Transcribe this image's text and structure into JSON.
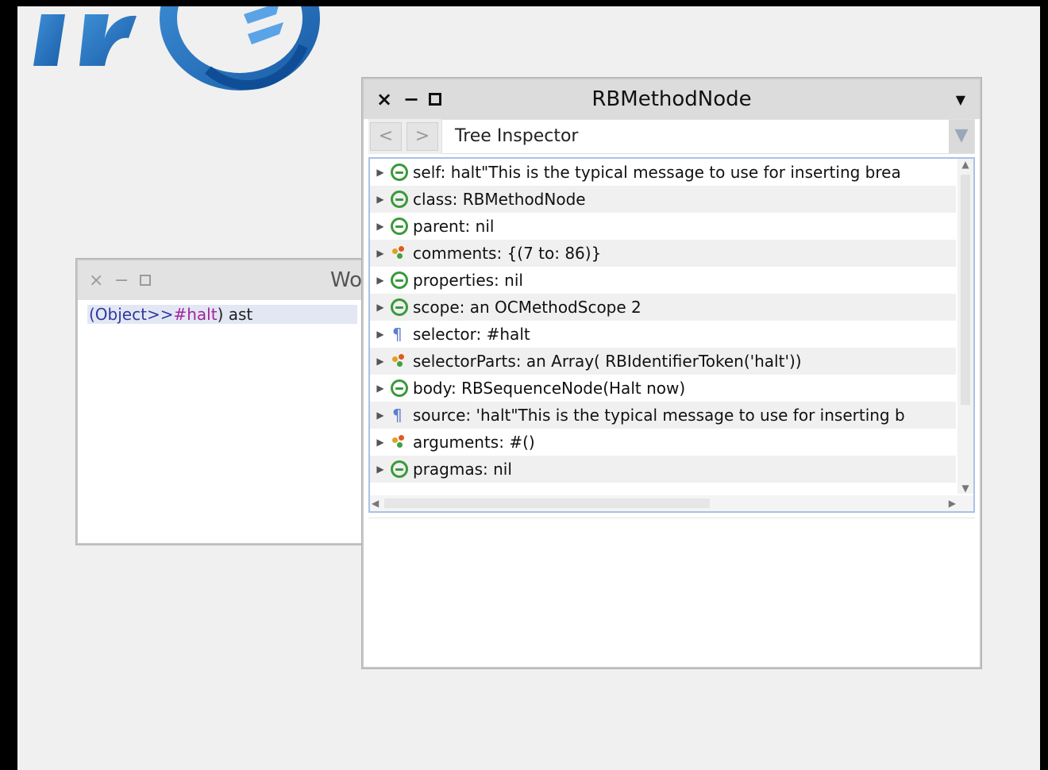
{
  "workspace": {
    "title": "Wo",
    "controls": {
      "close": "×",
      "minimize": "−"
    },
    "code_tokens": [
      {
        "text": "(Object>>",
        "kind": "class"
      },
      {
        "text": "#halt",
        "kind": "sym"
      },
      {
        "text": ") ast",
        "kind": "plain"
      }
    ]
  },
  "inspector": {
    "title": "RBMethodNode",
    "controls": {
      "close": "×",
      "minimize": "−",
      "menu": "▼"
    },
    "toolbar": {
      "back": "<",
      "forward": ">",
      "view": "Tree Inspector",
      "view_arrow": "▼"
    },
    "rows": [
      {
        "icon": "g",
        "text": "self: halt\"This is the typical message to use for inserting brea"
      },
      {
        "icon": "g",
        "text": "class: RBMethodNode"
      },
      {
        "icon": "g",
        "text": "parent: nil"
      },
      {
        "icon": "c",
        "text": "comments: {(7 to: 86)}"
      },
      {
        "icon": "g",
        "text": "properties: nil"
      },
      {
        "icon": "g",
        "text": "scope: an OCMethodScope 2"
      },
      {
        "icon": "p",
        "text": "selector: #halt"
      },
      {
        "icon": "c",
        "text": "selectorParts: an Array( RBIdentifierToken('halt'))"
      },
      {
        "icon": "g",
        "text": "body: RBSequenceNode(Halt now)"
      },
      {
        "icon": "p",
        "text": "source: 'halt\"This is the typical message to use for inserting b"
      },
      {
        "icon": "c",
        "text": "arguments: #()"
      },
      {
        "icon": "g",
        "text": "pragmas: nil"
      }
    ]
  }
}
